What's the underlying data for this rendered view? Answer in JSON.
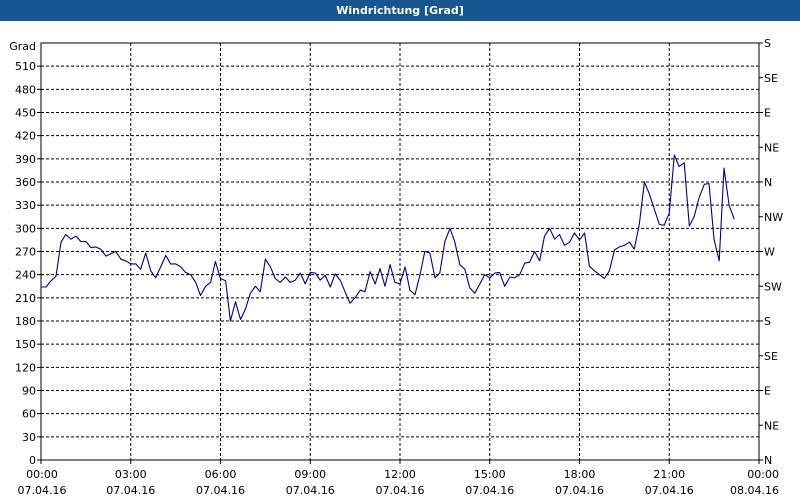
{
  "window": {
    "title": "Windrichtung [Grad]"
  },
  "chart_data": {
    "type": "line",
    "title": "Windrichtung [Grad]",
    "ylabel": "Grad",
    "xlabel": "",
    "ylim": [
      0,
      540
    ],
    "grid": true,
    "line_color": "#00008b",
    "y_ticks": [
      0,
      30,
      60,
      90,
      120,
      150,
      180,
      210,
      240,
      270,
      300,
      330,
      360,
      390,
      420,
      450,
      480,
      510
    ],
    "right_axis_labels": [
      {
        "value": 0,
        "label": "N"
      },
      {
        "value": 45,
        "label": "NE"
      },
      {
        "value": 90,
        "label": "E"
      },
      {
        "value": 135,
        "label": "SE"
      },
      {
        "value": 180,
        "label": "S"
      },
      {
        "value": 225,
        "label": "SW"
      },
      {
        "value": 270,
        "label": "W"
      },
      {
        "value": 315,
        "label": "NW"
      },
      {
        "value": 360,
        "label": "N"
      },
      {
        "value": 405,
        "label": "NE"
      },
      {
        "value": 450,
        "label": "E"
      },
      {
        "value": 495,
        "label": "SE"
      },
      {
        "value": 540,
        "label": "S"
      }
    ],
    "x_ticks": [
      {
        "hour": 0,
        "time": "00:00",
        "date": "07.04.16"
      },
      {
        "hour": 3,
        "time": "03:00",
        "date": "07.04.16"
      },
      {
        "hour": 6,
        "time": "06:00",
        "date": "07.04.16"
      },
      {
        "hour": 9,
        "time": "09:00",
        "date": "07.04.16"
      },
      {
        "hour": 12,
        "time": "12:00",
        "date": "07.04.16"
      },
      {
        "hour": 15,
        "time": "15:00",
        "date": "07.04.16"
      },
      {
        "hour": 18,
        "time": "18:00",
        "date": "07.04.16"
      },
      {
        "hour": 21,
        "time": "21:00",
        "date": "07.04.16"
      },
      {
        "hour": 24,
        "time": "00:00",
        "date": "08.04.16"
      }
    ],
    "x_hours": [
      0,
      0.17,
      0.33,
      0.5,
      0.67,
      0.83,
      1.0,
      1.17,
      1.33,
      1.5,
      1.67,
      1.83,
      2.0,
      2.17,
      2.33,
      2.5,
      2.67,
      2.83,
      3.0,
      3.17,
      3.33,
      3.5,
      3.67,
      3.83,
      4.0,
      4.17,
      4.33,
      4.5,
      4.67,
      4.83,
      5.0,
      5.17,
      5.33,
      5.5,
      5.67,
      5.83,
      6.0,
      6.17,
      6.33,
      6.5,
      6.67,
      6.83,
      7.0,
      7.17,
      7.33,
      7.5,
      7.67,
      7.83,
      8.0,
      8.17,
      8.33,
      8.5,
      8.67,
      8.83,
      9.0,
      9.17,
      9.33,
      9.5,
      9.67,
      9.83,
      10.0,
      10.17,
      10.33,
      10.5,
      10.67,
      10.83,
      11.0,
      11.17,
      11.33,
      11.5,
      11.67,
      11.83,
      12.0,
      12.17,
      12.33,
      12.5,
      12.67,
      12.83,
      13.0,
      13.17,
      13.33,
      13.5,
      13.67,
      13.83,
      14.0,
      14.17,
      14.33,
      14.5,
      14.67,
      14.83,
      15.0,
      15.17,
      15.33,
      15.5,
      15.67,
      15.83,
      16.0,
      16.17,
      16.33,
      16.5,
      16.67,
      16.83,
      17.0,
      17.17,
      17.33,
      17.5,
      17.67,
      17.83,
      18.0,
      18.17,
      18.33,
      18.5,
      18.67,
      18.83,
      19.0,
      19.17,
      19.33,
      19.5,
      19.67,
      19.83,
      20.0,
      20.17,
      20.33,
      20.5,
      20.67,
      20.83,
      21.0,
      21.17,
      21.33,
      21.5,
      21.67,
      21.83,
      22.0,
      22.17,
      22.33,
      22.5,
      22.67,
      22.83,
      23.0,
      23.17,
      23.33,
      23.5,
      23.67,
      23.83,
      24.0
    ],
    "y_values": [
      224,
      224,
      232,
      238,
      282,
      292,
      286,
      290,
      283,
      283,
      275,
      276,
      273,
      264,
      267,
      270,
      260,
      258,
      254,
      254,
      247,
      268,
      245,
      236,
      250,
      265,
      254,
      254,
      250,
      243,
      240,
      230,
      213,
      225,
      230,
      257,
      235,
      232,
      180,
      205,
      182,
      195,
      216,
      225,
      218,
      260,
      250,
      235,
      230,
      237,
      230,
      233,
      242,
      228,
      243,
      242,
      233,
      239,
      224,
      241,
      233,
      217,
      203,
      210,
      220,
      218,
      244,
      228,
      248,
      225,
      253,
      230,
      228,
      250,
      220,
      214,
      240,
      270,
      268,
      236,
      242,
      283,
      300,
      283,
      253,
      247,
      223,
      216,
      228,
      240,
      236,
      242,
      243,
      225,
      237,
      236,
      240,
      255,
      256,
      270,
      258,
      290,
      300,
      286,
      292,
      278,
      282,
      294,
      285,
      294,
      251,
      245,
      240,
      235,
      245,
      272,
      276,
      278,
      282,
      273,
      305,
      360,
      345,
      325,
      305,
      304,
      320,
      395,
      380,
      385,
      303,
      315,
      340,
      357,
      358,
      285,
      258,
      378,
      330,
      312
    ]
  }
}
